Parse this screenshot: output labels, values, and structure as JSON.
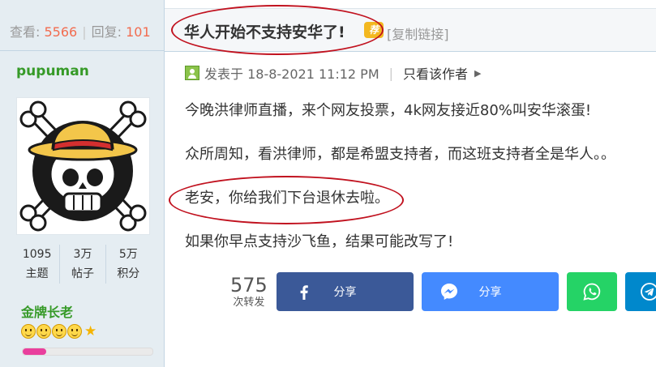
{
  "thread_stats": {
    "views_label": "查看:",
    "views": "5566",
    "replies_label": "回复:",
    "replies": "101"
  },
  "author": {
    "name": "pupuman",
    "stats": [
      {
        "value": "1095",
        "label": "主题"
      },
      {
        "value": "3万",
        "label": "帖子"
      },
      {
        "value": "5万",
        "label": "积分"
      }
    ],
    "rank": "金牌长老",
    "level_icons": 4,
    "progress": 0.18,
    "colors": {
      "name": "#369a28",
      "progress": "#e93f9d"
    }
  },
  "post": {
    "title": "华人开始不支持安华了!",
    "badge": "荐",
    "copy_link": "[复制链接]",
    "posted": "发表于 18-8-2021 11:12 PM",
    "author_only": "只看该作者",
    "paragraphs": [
      "今晚洪律师直播，来个网友投票，4k网友接近80%叫安华滚蛋!",
      "众所周知，看洪律师，都是希盟支持者，而这班支持者全是华人。。",
      "老安，你给我们下台退休去啦。",
      "如果你早点支持沙飞鱼，结果可能改写了!"
    ]
  },
  "share": {
    "count": "575",
    "count_label": "次转发",
    "facebook_label": "分享",
    "messenger_label": "分享",
    "colors": {
      "facebook": "#3b5998",
      "messenger": "#448aff",
      "whatsapp": "#25d366",
      "telegram": "#0088cc"
    },
    "icons": [
      "facebook-icon",
      "messenger-icon",
      "whatsapp-icon",
      "telegram-icon"
    ]
  },
  "annotation_color": "#c1121f"
}
